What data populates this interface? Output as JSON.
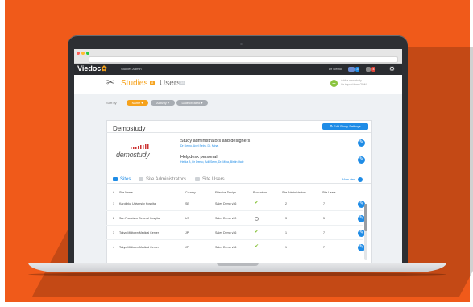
{
  "colors": {
    "background": "#f05a1a",
    "accent": "#f6a21c",
    "primary": "#1f8ce6",
    "success": "#8ac43f"
  },
  "app": {
    "logo": "Viedoc",
    "app_name": "Studies Admin",
    "user_name": "Dr Demo",
    "badge_messages": "3",
    "badge_alerts": "4"
  },
  "header": {
    "tab_studies": "Studies",
    "tab_studies_count": "8",
    "tab_users": "Users",
    "tab_users_count": "38",
    "add_study_line1": "Add a new study",
    "add_study_line2": "Or import from ODM"
  },
  "sort": {
    "label": "Sort by",
    "options": [
      "Name",
      "Activity",
      "Date created"
    ]
  },
  "study": {
    "title": "Demostudy",
    "edit_button": "Edit Study Settings",
    "logo_text": "demostudy",
    "section1_title": "Study administrators and designers",
    "section1_names": "Dr Demo, Axel Selm, Dr. Mina,",
    "section2_title": "Helpdesk personal",
    "section2_names": "Helda B, Dr Demo, Adil Selm, Dr. Mina, Bistin Hale"
  },
  "tabs": {
    "sites": "Sites",
    "site_admins": "Site Administrators",
    "site_users": "Site Users",
    "more_view": "More view"
  },
  "table": {
    "headers": [
      "#",
      "Site Name",
      "Country",
      "Effective Design",
      "Production",
      "Site Administrators",
      "Site Users"
    ],
    "rows": [
      {
        "n": "1",
        "site": "Karolinka University Hospital",
        "country": "SE",
        "design": "Sales Demo v36",
        "production": "check",
        "admins": "2",
        "users": "7"
      },
      {
        "n": "2",
        "site": "San Francisco General Hospital",
        "country": "US",
        "design": "Sales Demo v20",
        "production": "pending",
        "admins": "3",
        "users": "5"
      },
      {
        "n": "3",
        "site": "Tokyo Midtown Medical Center",
        "country": "JP",
        "design": "Sales Demo v36",
        "production": "check",
        "admins": "1",
        "users": "7"
      },
      {
        "n": "4",
        "site": "Tokyo Midtown Medical Center",
        "country": "JP",
        "design": "Sales Demo v36",
        "production": "check",
        "admins": "1",
        "users": "7"
      }
    ]
  }
}
